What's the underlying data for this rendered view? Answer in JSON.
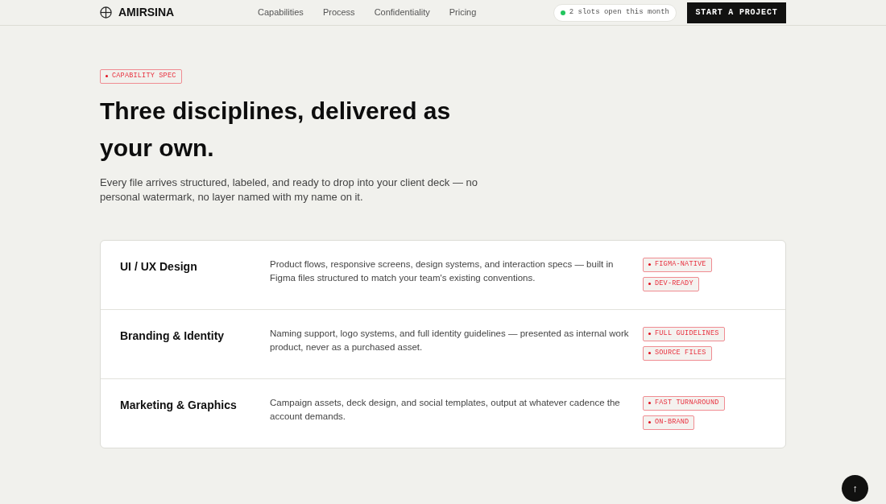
{
  "header": {
    "brand": "AMIRSINA",
    "nav": [
      "Capabilities",
      "Process",
      "Confidentiality",
      "Pricing"
    ],
    "status": "2 slots open this month",
    "cta": "START A PROJECT"
  },
  "hero": {
    "tag": "CAPABILITY SPEC",
    "title": "Three disciplines, delivered as your own.",
    "description": "Every file arrives structured, labeled, and ready to drop into your client deck — no personal watermark, no layer named with my name on it."
  },
  "capabilities": [
    {
      "title": "UI / UX Design",
      "description": "Product flows, responsive screens, design systems, and interaction specs — built in Figma files structured to match your team's existing conventions.",
      "tags": [
        "FIGMA-NATIVE",
        "DEV-READY"
      ]
    },
    {
      "title": "Branding & Identity",
      "description": "Naming support, logo systems, and full identity guidelines — presented as internal work product, never as a purchased asset.",
      "tags": [
        "FULL GUIDELINES",
        "SOURCE FILES"
      ]
    },
    {
      "title": "Marketing & Graphics",
      "description": "Campaign assets, deck design, and social templates, output at whatever cadence the account demands.",
      "tags": [
        "FAST TURNAROUND",
        "ON-BRAND"
      ]
    }
  ],
  "scroll_top": "↑"
}
